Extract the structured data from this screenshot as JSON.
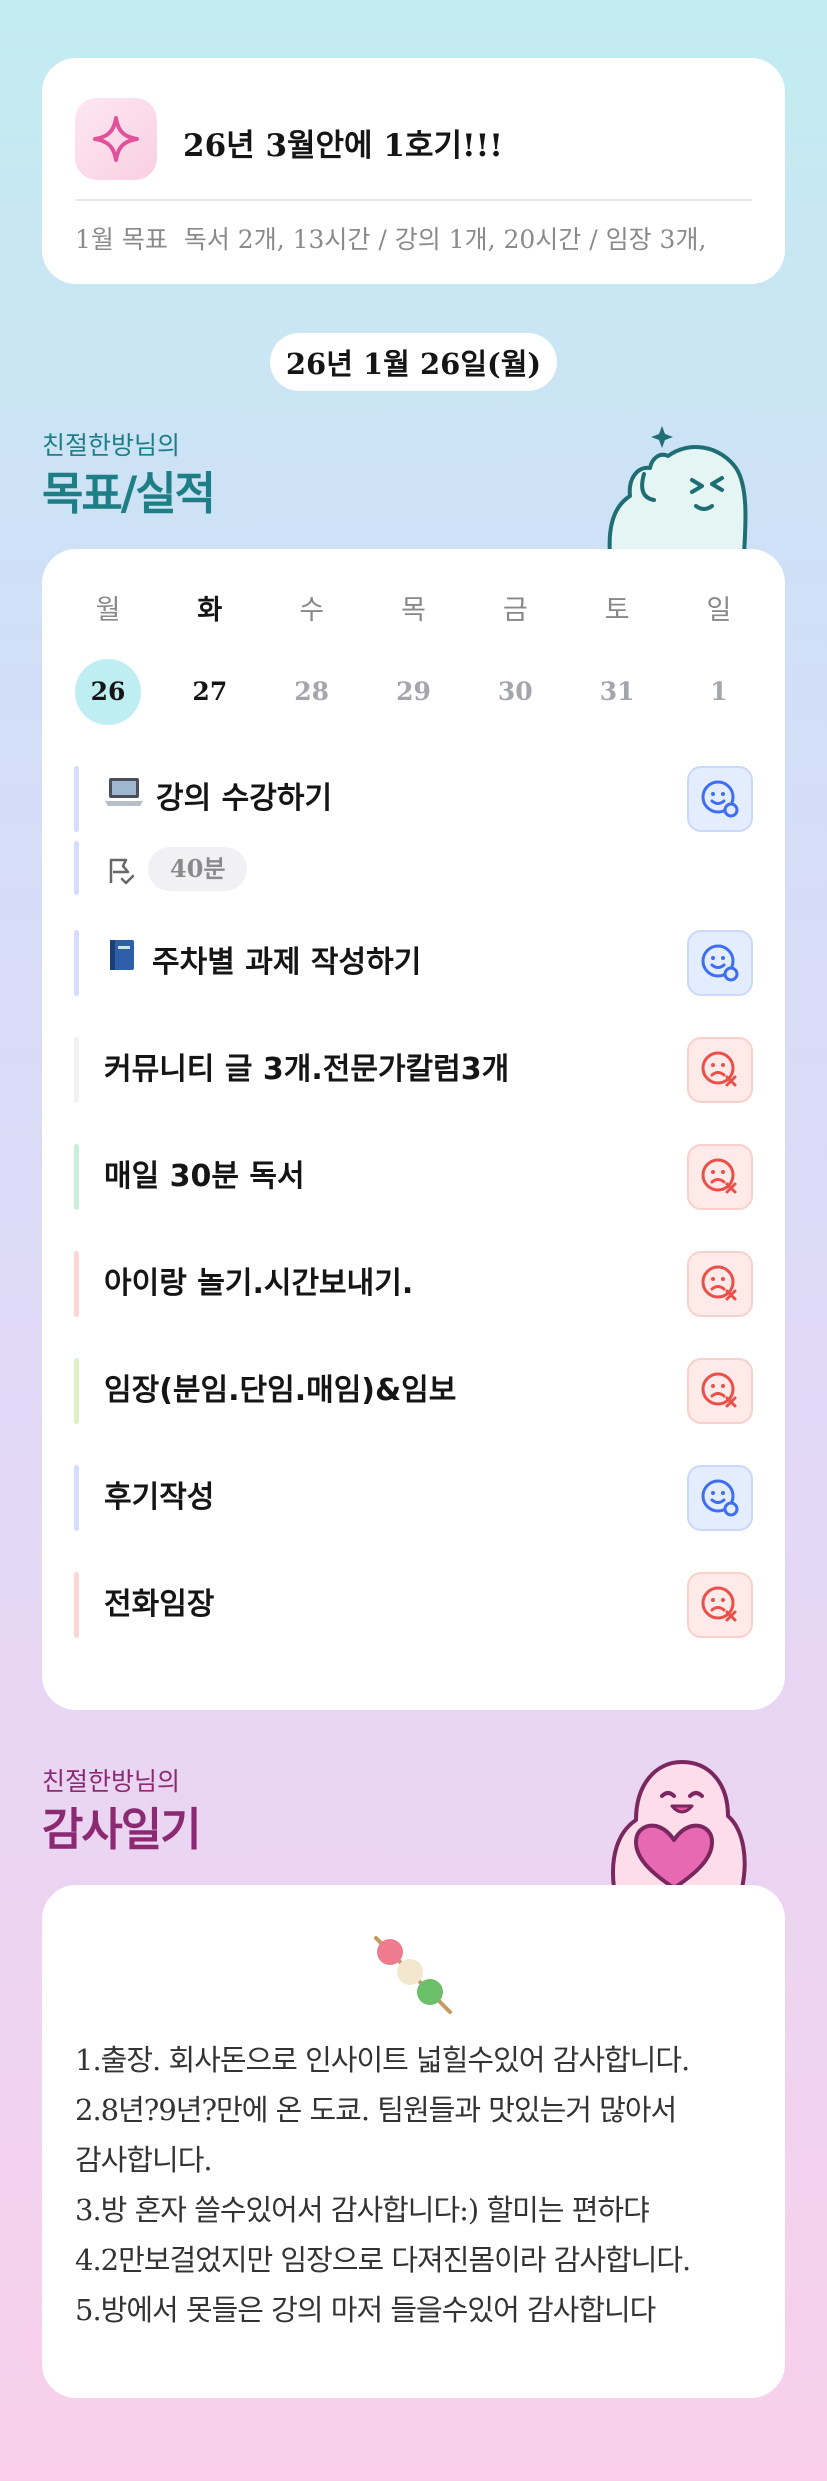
{
  "goal": {
    "icon": "sparkle-icon",
    "title": "26년 3월안에 1호기!!!",
    "summary_label": "1월 목표",
    "summary_text": "독서 2개, 13시간 / 강의 1개, 20시간 / 임장 3개,"
  },
  "date_label": "26년 1월 26일(월)",
  "routine_section": {
    "subtitle": "친절한방님의",
    "title": "목표/실적",
    "accent_color": "#1e7e86"
  },
  "week": [
    {
      "day": "월",
      "date": "26"
    },
    {
      "day": "화",
      "date": "27"
    },
    {
      "day": "수",
      "date": "28"
    },
    {
      "day": "목",
      "date": "29"
    },
    {
      "day": "금",
      "date": "30"
    },
    {
      "day": "토",
      "date": "31"
    },
    {
      "day": "일",
      "date": "1"
    }
  ],
  "tasks": [
    {
      "icon": "laptop-icon",
      "name": "강의 수강하기",
      "status": "done",
      "duration": "40분",
      "bar_color": "#d6dcfd"
    },
    {
      "icon": "book-icon",
      "name": "주차별 과제 작성하기",
      "status": "done",
      "bar_color": "#d6dcfd"
    },
    {
      "name": "커뮤니티 글 3개.전문가칼럼3개",
      "status": "fail",
      "bar_color": "#f2f2f2"
    },
    {
      "name": "매일 30분 독서",
      "status": "fail",
      "bar_color": "#c6f0dc"
    },
    {
      "name": "아이랑 놀기.시간보내기.",
      "status": "fail",
      "bar_color": "#fdd5d5"
    },
    {
      "name": "임장(분임.단임.매임)&임보",
      "status": "fail",
      "bar_color": "#dff0c2"
    },
    {
      "name": "후기작성",
      "status": "done",
      "bar_color": "#d6dcfd"
    },
    {
      "name": "전화임장",
      "status": "fail",
      "bar_color": "#fdd5d5"
    }
  ],
  "status_colors": {
    "done": "#3f6ef0",
    "fail": "#e9504a"
  },
  "gratitude_section": {
    "subtitle": "친절한방님의",
    "title": "감사일기",
    "accent_color": "#8b2a72"
  },
  "diary": {
    "icon": "dango-icon",
    "lines": [
      "1.출장. 회사돈으로 인사이트 넓힐수있어 감사합니다.",
      "2.8년?9년?만에 온 도쿄. 팀원들과 맛있는거 많아서",
      "감사합니다.",
      "3.방 혼자 쓸수있어서 감사합니다:) 할미는 편하댜",
      "4.2만보걸었지만 임장으로 다져진몸이라 감사합니다.",
      "5.방에서 못들은 강의 마저 들을수있어 감사합니다"
    ]
  }
}
